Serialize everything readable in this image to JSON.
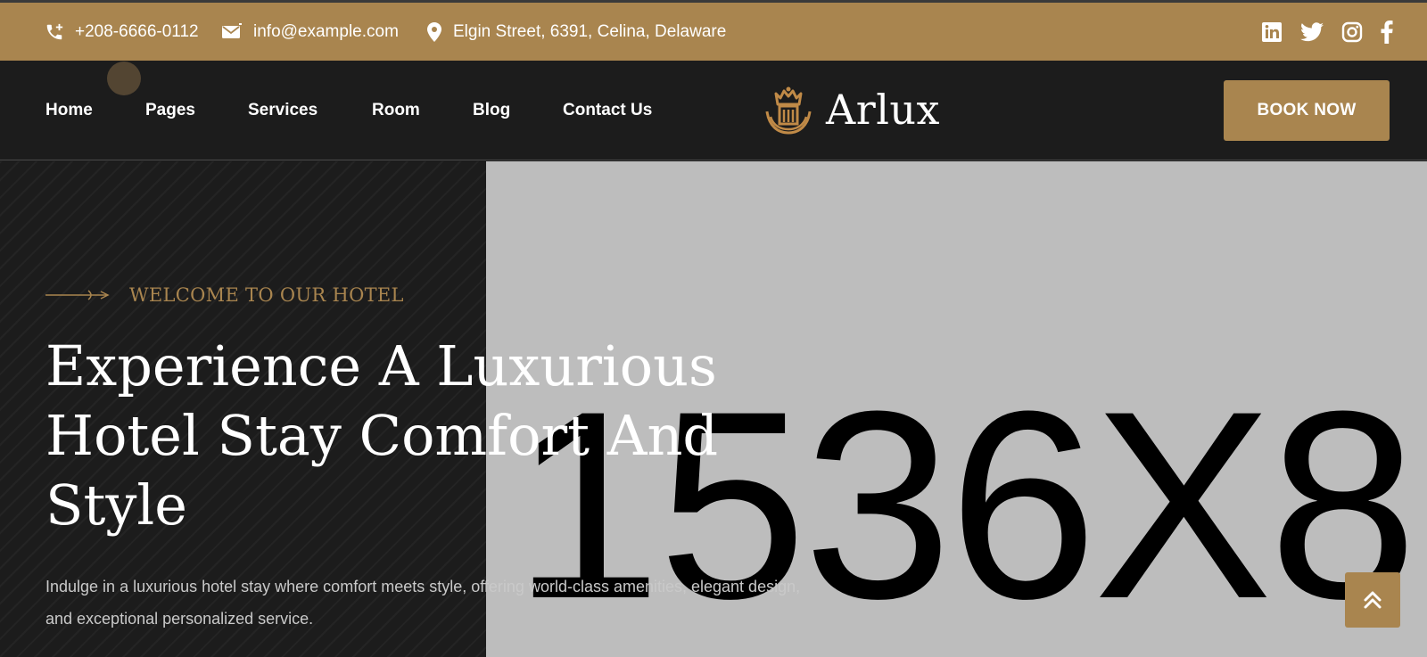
{
  "topbar": {
    "phone": "+208-6666-0112",
    "email": "info@example.com",
    "address": "Elgin Street, 6391, Celina, Delaware",
    "socials": [
      "linkedin-icon",
      "twitter-icon",
      "instagram-icon",
      "facebook-icon"
    ]
  },
  "nav": {
    "items": [
      "Home",
      "Pages",
      "Services",
      "Room",
      "Blog",
      "Contact Us"
    ],
    "book_label": "BOOK NOW"
  },
  "logo": {
    "text": "Arlux",
    "icon": "crown-building-icon"
  },
  "hero": {
    "tagline": "WELCOME TO OUR HOTEL",
    "headline": "Experience A Luxurious Hotel Stay Comfort And Style",
    "description": "Indulge in a luxurious hotel stay where comfort meets style, offering world-class amenities, elegant design, and exceptional personalized service.",
    "image_placeholder": "1536X8"
  },
  "scroll_top_icon": "double-chevron-up-icon",
  "colors": {
    "accent": "#a9854f",
    "dark": "#1c1c1c",
    "placeholder": "#bdbdbd"
  }
}
